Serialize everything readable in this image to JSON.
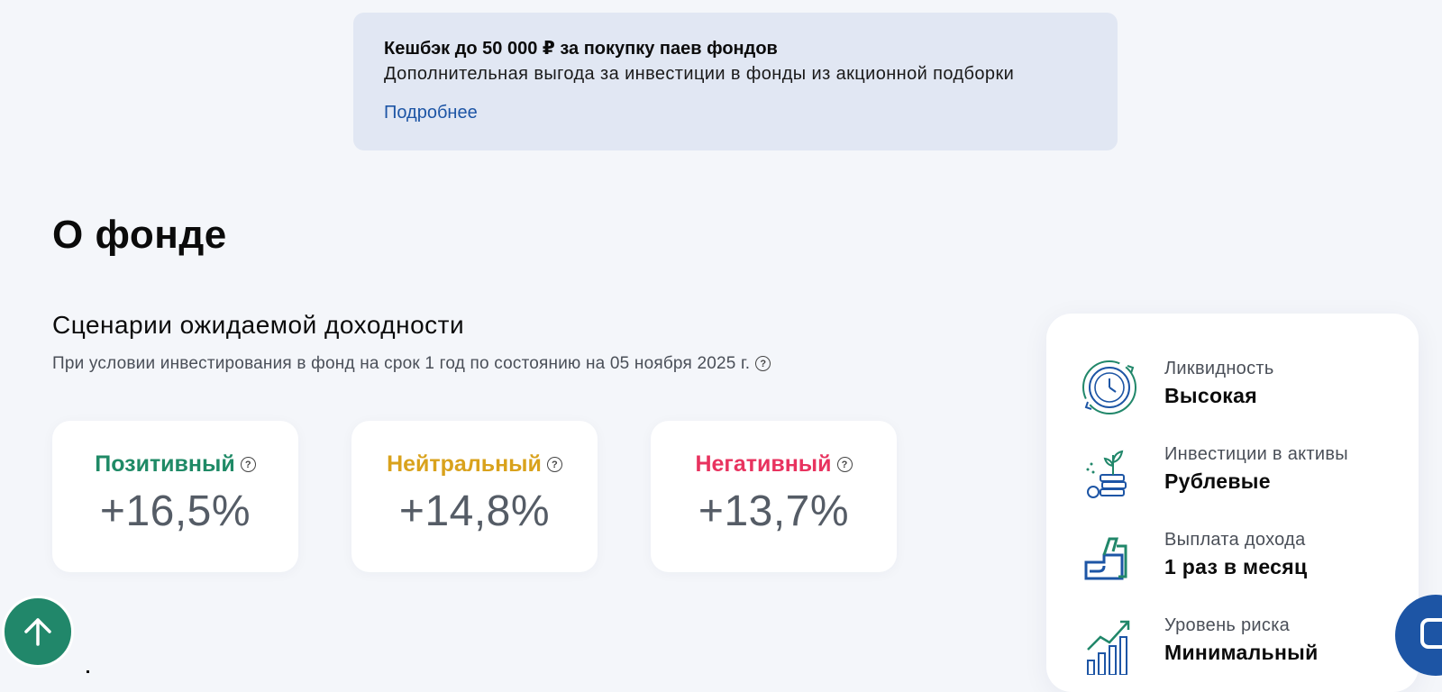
{
  "banner": {
    "title": "Кешбэк до 50 000 ₽ за покупку паев фондов",
    "text": "Дополнительная выгода за инвестиции в фонды из акционной подборки",
    "link": "Подробнее"
  },
  "section": {
    "title": "О фонде"
  },
  "scenarios": {
    "title": "Сценарии ожидаемой доходности",
    "subtitle": "При условии инвестирования в фонд на срок 1 год по состоянию на 05 ноября 2025 г.",
    "help_symbol": "?",
    "cards": [
      {
        "label": "Позитивный",
        "value": "+16,5%",
        "color": "#1f8a66"
      },
      {
        "label": "Нейтральный",
        "value": "+14,8%",
        "color": "#d9a21c"
      },
      {
        "label": "Негативный",
        "value": "+13,7%",
        "color": "#e8335f"
      }
    ]
  },
  "info": {
    "items": [
      {
        "label": "Ликвидность",
        "value": "Высокая",
        "icon": "clock-cycle-icon"
      },
      {
        "label": "Инвестиции в активы",
        "value": "Рублевые",
        "icon": "coins-plant-icon"
      },
      {
        "label": "Выплата дохода",
        "value": "1 раз в месяц",
        "icon": "payment-hand-icon"
      },
      {
        "label": "Уровень риска",
        "value": "Минимальный",
        "icon": "growth-chart-icon"
      }
    ]
  },
  "colors": {
    "accent": "#21876a",
    "brand_blue": "#1d55a5",
    "banner_bg": "#e1e7f3"
  },
  "controls": {
    "up_button_icon": "arrow-up-icon",
    "chat_button_icon": "chat-icon"
  }
}
